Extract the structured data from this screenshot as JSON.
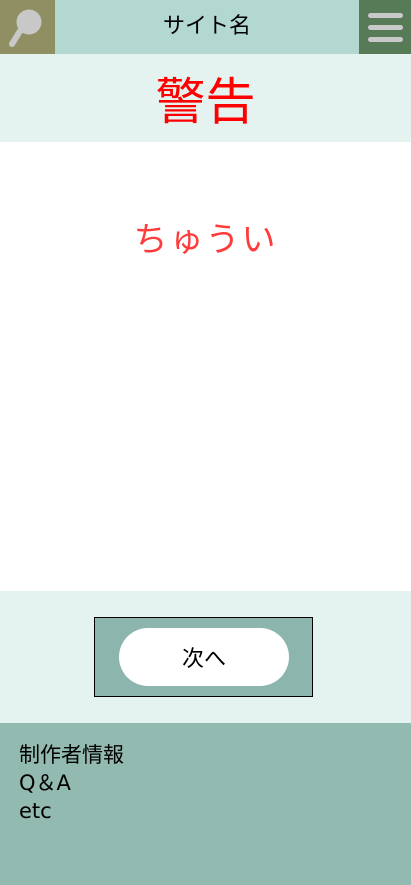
{
  "header": {
    "site_title": "サイト名",
    "search_icon": "search-icon",
    "menu_icon": "hamburger-menu-icon"
  },
  "heading": {
    "title": "警告"
  },
  "main": {
    "message": "ちゅうい"
  },
  "action": {
    "next_label": "次へ"
  },
  "footer": {
    "links": [
      {
        "label": "制作者情報"
      },
      {
        "label": "Q＆A"
      },
      {
        "label": "etc"
      }
    ]
  },
  "colors": {
    "header_bg": "#b2d8d1",
    "search_bg": "#8f8f63",
    "menu_bg": "#567b56",
    "band_bg": "#e4f3ef",
    "title_red": "#ff0000",
    "message_red": "#ff3b3b",
    "action_box_bg": "#8cb5ad",
    "footer_bg": "#93bab1"
  }
}
